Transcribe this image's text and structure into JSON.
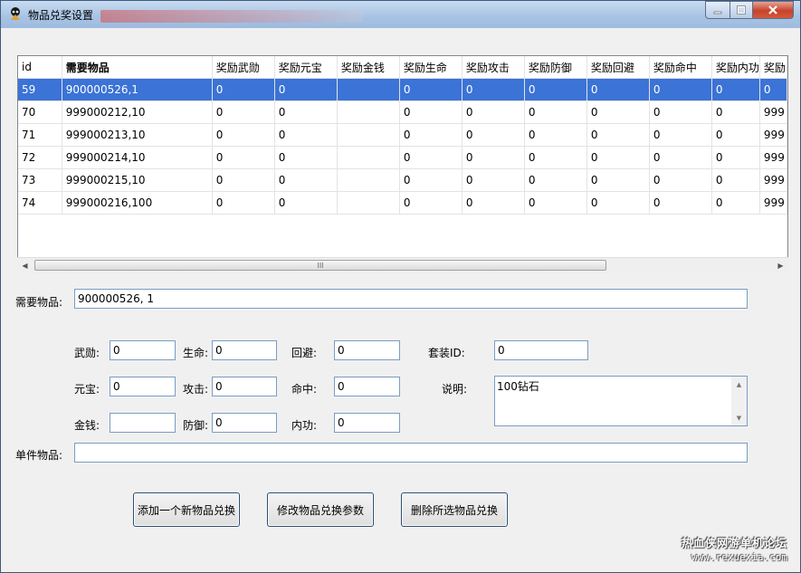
{
  "window": {
    "title": "物品兑奖设置"
  },
  "table": {
    "columns": [
      "id",
      "需要物品",
      "奖励武勋",
      "奖励元宝",
      "奖励金钱",
      "奖励生命",
      "奖励攻击",
      "奖励防御",
      "奖励回避",
      "奖励命中",
      "奖励内功",
      "奖励"
    ],
    "rows": [
      [
        "59",
        "900000526,1",
        "0",
        "0",
        "",
        "0",
        "0",
        "0",
        "0",
        "0",
        "0",
        "0"
      ],
      [
        "70",
        "999000212,10",
        "0",
        "0",
        "",
        "0",
        "0",
        "0",
        "0",
        "0",
        "0",
        "999"
      ],
      [
        "71",
        "999000213,10",
        "0",
        "0",
        "",
        "0",
        "0",
        "0",
        "0",
        "0",
        "0",
        "999"
      ],
      [
        "72",
        "999000214,10",
        "0",
        "0",
        "",
        "0",
        "0",
        "0",
        "0",
        "0",
        "0",
        "999"
      ],
      [
        "73",
        "999000215,10",
        "0",
        "0",
        "",
        "0",
        "0",
        "0",
        "0",
        "0",
        "0",
        "999"
      ],
      [
        "74",
        "999000216,100",
        "0",
        "0",
        "",
        "0",
        "0",
        "0",
        "0",
        "0",
        "0",
        "999"
      ]
    ],
    "selected_row": 0,
    "scroll_thumb_glyph": "III"
  },
  "form": {
    "required_item_label": "需要物品:",
    "required_item_value": "900000526, 1",
    "wuxun_label": "武勋:",
    "wuxun_value": "0",
    "life_label": "生命:",
    "life_value": "0",
    "dodge_label": "回避:",
    "dodge_value": "0",
    "set_id_label": "套装ID:",
    "set_id_value": "0",
    "yuanbao_label": "元宝:",
    "yuanbao_value": "0",
    "attack_label": "攻击:",
    "attack_value": "0",
    "hit_label": "命中:",
    "hit_value": "0",
    "desc_label": "说明:",
    "desc_value": "100钻石",
    "money_label": "金钱:",
    "money_value": "",
    "defense_label": "防御:",
    "defense_value": "0",
    "neigong_label": "内功:",
    "neigong_value": "0",
    "single_item_label": "单件物品:",
    "single_item_value": ""
  },
  "buttons": {
    "add": "添加一个新物品兑换",
    "modify": "修改物品兑换参数",
    "delete": "删除所选物品兑换"
  },
  "watermark": {
    "line1": "热血侠网游单机论坛",
    "line2": "www.rexuexia.com"
  },
  "colors": {
    "selection": "#3b73d6",
    "title_bar": "#a9c4e3",
    "close_button": "#c7432a"
  }
}
